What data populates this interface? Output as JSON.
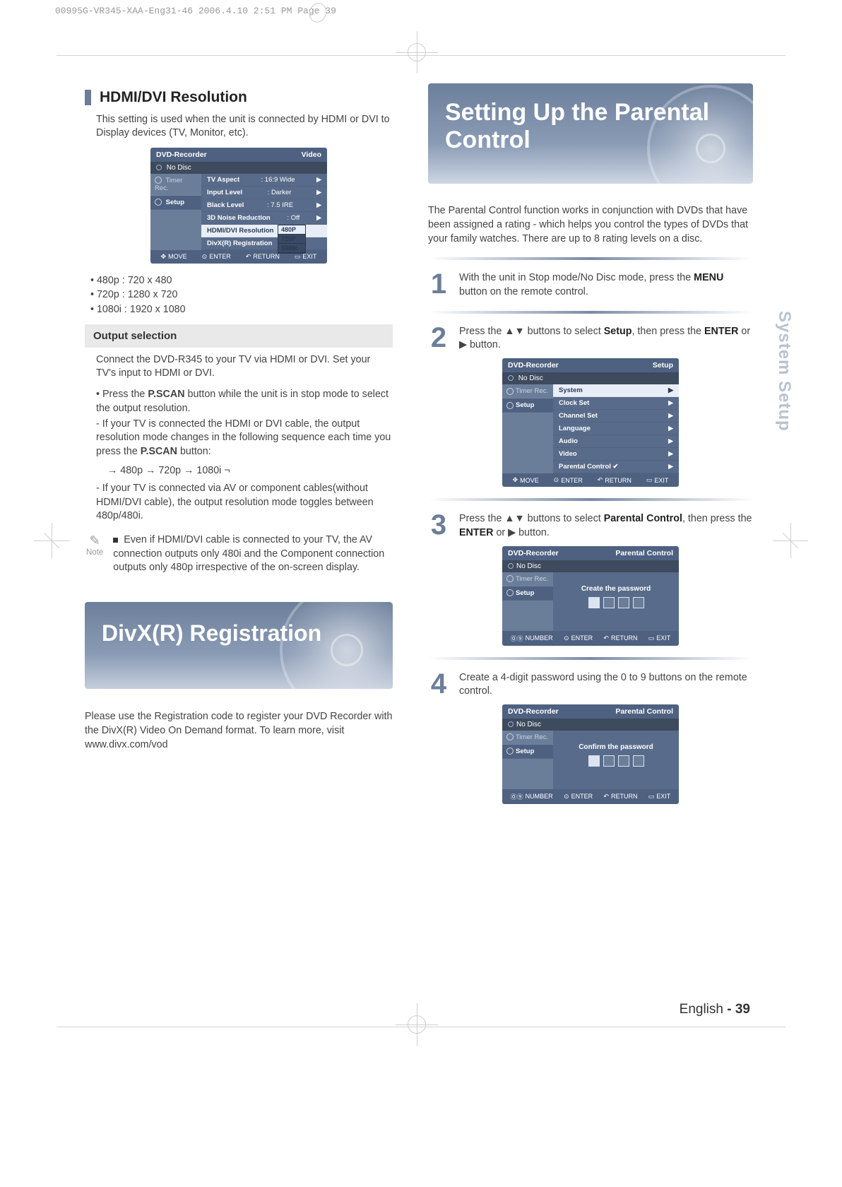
{
  "header_line": "00995G-VR345-XAA-Eng31-46  2006.4.10  2:51 PM  Page 39",
  "left": {
    "section_title": "HDMI/DVI Resolution",
    "intro": "This setting is used when the unit is connected by HDMI or DVI to Display devices (TV, Monitor, etc).",
    "osd_video": {
      "title": "DVD-Recorder",
      "title_right": "Video",
      "status": "No Disc",
      "side": {
        "timer": "Timer Rec.",
        "setup": "Setup"
      },
      "rows": [
        {
          "label": "TV Aspect",
          "val": ": 16:9 Wide"
        },
        {
          "label": "Input Level",
          "val": ": Darker"
        },
        {
          "label": "Black Level",
          "val": ": 7.5 IRE"
        },
        {
          "label": "3D Noise Reduction",
          "val": ": Off"
        },
        {
          "label": "HDMI/DVI Resolution",
          "val": ""
        },
        {
          "label": "DivX(R) Registration",
          "val": ""
        }
      ],
      "dropdown": [
        "480P",
        "720P",
        "1080i"
      ],
      "foot": {
        "move": "MOVE",
        "enter": "ENTER",
        "ret": "RETURN",
        "exit": "EXIT"
      }
    },
    "res_bullets": "• 480p : 720 x 480\n• 720p : 1280 x 720\n• 1080i : 1920 x 1080",
    "output_heading": "Output selection",
    "output_p1": "Connect the DVD-R345 to your TV via HDMI or DVI. Set your TV's input to HDMI or DVI.",
    "output_b1": "• Press the P.SCAN button while the unit is in stop mode to select the output resolution.",
    "output_b2": "- If your TV is connected the HDMI or DVI cable, the output resolution mode changes in the following sequence each time you press the P.SCAN button:",
    "cycle": "→ 480p → 720p → 1080i ¬",
    "output_b3": "- If your TV is connected via AV or component cables(without HDMI/DVI cable), the output resolution mode toggles between 480p/480i.",
    "note_label": "Note",
    "note_text": "Even if  HDMI/DVI cable is connected to your TV, the AV connection outputs only 480i and the Component connection outputs only 480p irrespective of the on-screen display.",
    "divx_title": "DivX(R) Registration",
    "divx_desc": "Please use the Registration code to register your DVD Recorder with the DivX(R) Video On Demand format. To learn more, visit www.divx.com/vod"
  },
  "right": {
    "title": "Setting Up the Parental Control",
    "desc": "The Parental Control function works in conjunction with DVDs that have been assigned a rating - which helps you control the types of DVDs that your family watches. There are up to 8 rating levels on a disc.",
    "steps": {
      "s1": "With the unit in Stop mode/No Disc mode, press the MENU button on the remote control.",
      "s2": "Press the ▲▼ buttons to select Setup, then press the ENTER or ▶ button.",
      "s3": "Press the ▲▼ buttons to select Parental Control, then press the ENTER or ▶ button.",
      "s4": "Create a 4-digit password using the 0 to 9 buttons on the remote control."
    },
    "osd_setup": {
      "title": "DVD-Recorder",
      "title_right": "Setup",
      "status": "No Disc",
      "side": {
        "timer": "Timer Rec.",
        "setup": "Setup"
      },
      "rows": [
        "System",
        "Clock Set",
        "Channel Set",
        "Language",
        "Audio",
        "Video",
        "Parental Control ✔"
      ],
      "foot": {
        "move": "MOVE",
        "enter": "ENTER",
        "ret": "RETURN",
        "exit": "EXIT"
      }
    },
    "osd_create": {
      "title": "DVD-Recorder",
      "title_right": "Parental Control",
      "status": "No Disc",
      "side": {
        "timer": "Timer Rec.",
        "setup": "Setup"
      },
      "center": "Create the password",
      "foot": {
        "num": "NUMBER",
        "enter": "ENTER",
        "ret": "RETURN",
        "exit": "EXIT"
      }
    },
    "osd_confirm": {
      "title": "DVD-Recorder",
      "title_right": "Parental Control",
      "status": "No Disc",
      "side": {
        "timer": "Timer Rec.",
        "setup": "Setup"
      },
      "center": "Confirm the password",
      "foot": {
        "num": "NUMBER",
        "enter": "ENTER",
        "ret": "RETURN",
        "exit": "EXIT"
      }
    }
  },
  "side_tab": "System Setup",
  "footer": {
    "lang": "English",
    "sep": " - ",
    "page": "39"
  }
}
